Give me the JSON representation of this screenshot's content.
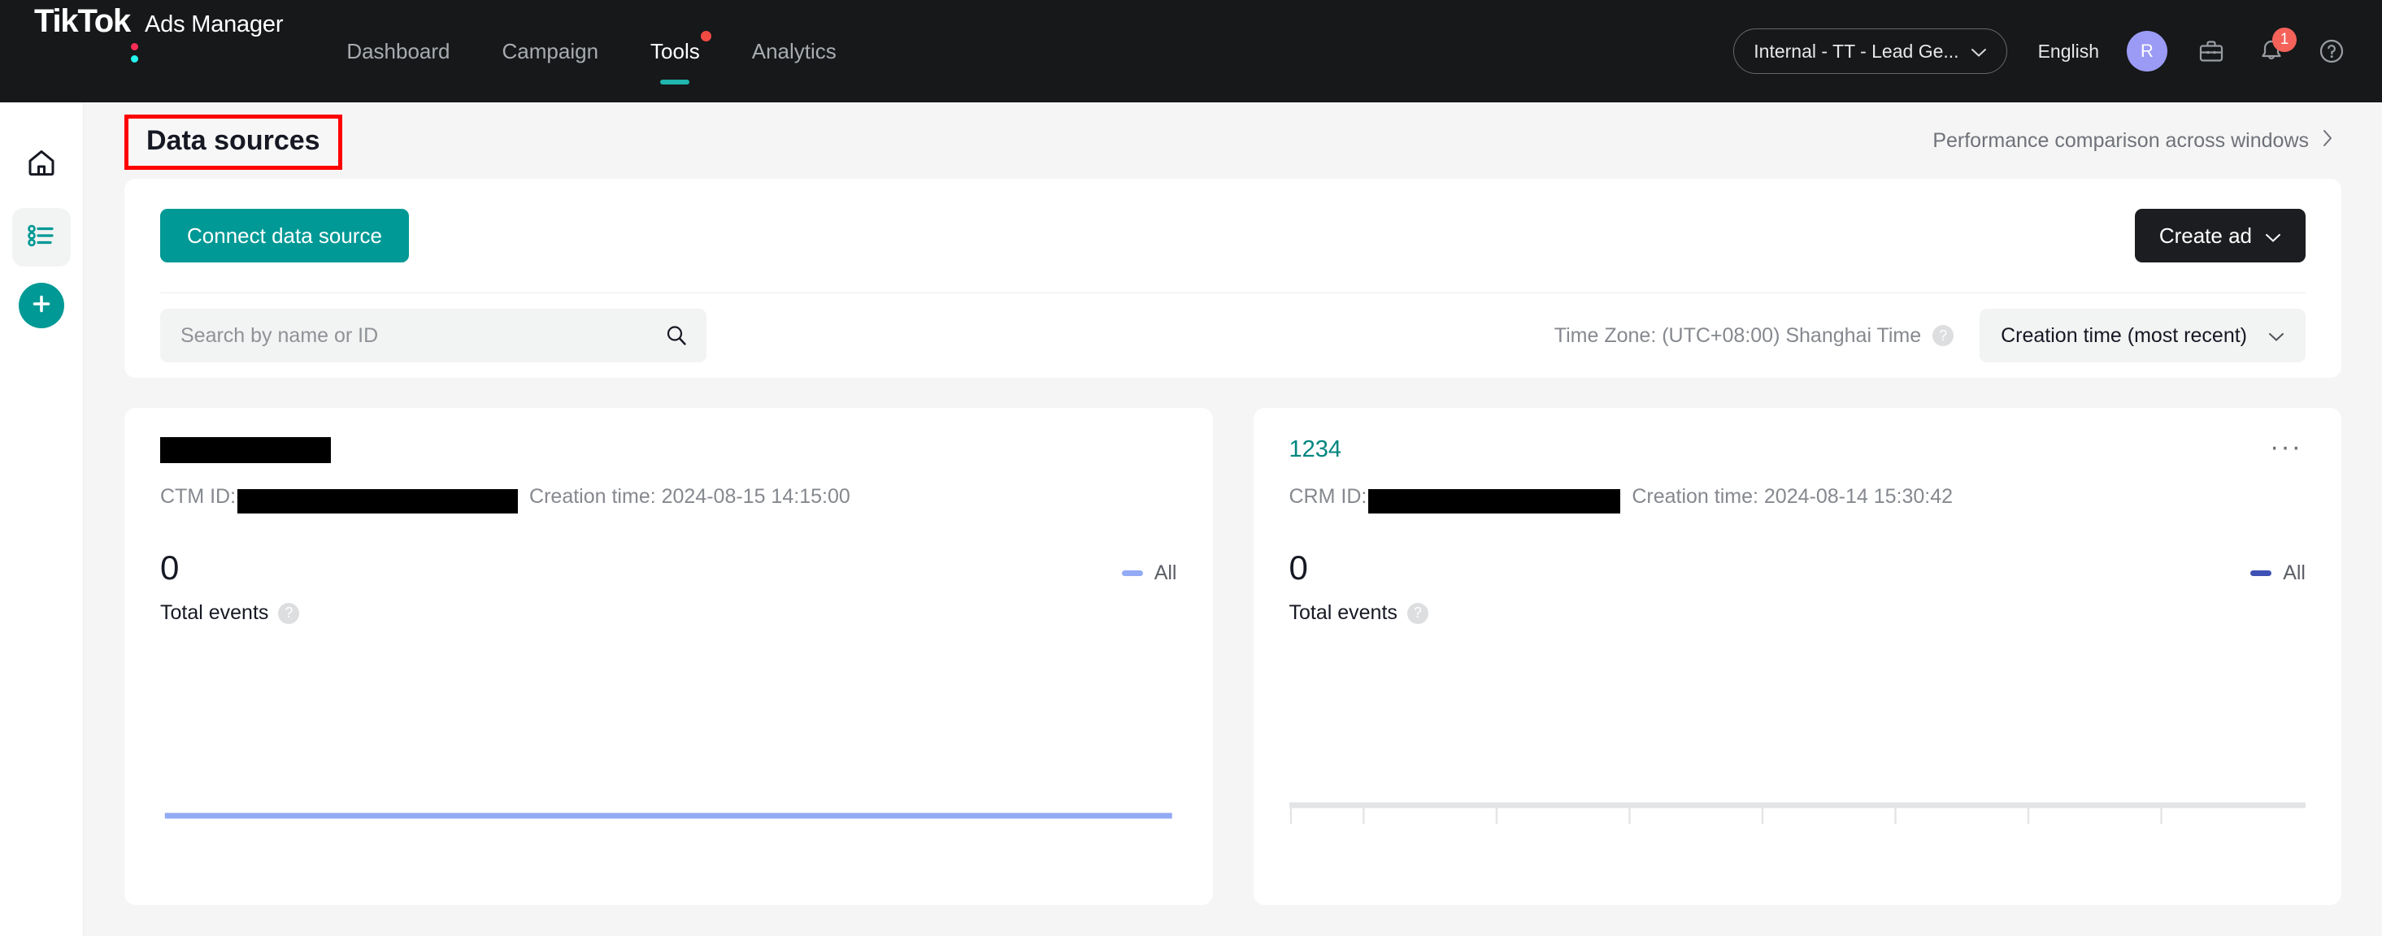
{
  "topnav": {
    "brand_name": "TikTok",
    "brand_sub": "Ads Manager",
    "tabs": [
      {
        "label": "Dashboard",
        "active": false,
        "dot": false
      },
      {
        "label": "Campaign",
        "active": false,
        "dot": false
      },
      {
        "label": "Tools",
        "active": true,
        "dot": true
      },
      {
        "label": "Analytics",
        "active": false,
        "dot": false
      }
    ],
    "account": "Internal - TT - Lead Ge...",
    "language": "English",
    "avatar_initial": "R",
    "notification_count": "1",
    "icons": {
      "briefcase": "briefcase-icon",
      "bell": "bell-icon",
      "help": "help-circle-icon",
      "chevron": "chevron-down-icon"
    }
  },
  "sidebar": {
    "items": [
      {
        "name": "home",
        "label": "Home",
        "active": false
      },
      {
        "name": "data-sources",
        "label": "Data sources",
        "active": true
      }
    ],
    "fab_label": "Create"
  },
  "page": {
    "title": "Data sources",
    "performance_link": "Performance comparison across windows",
    "performance_chevron": "›"
  },
  "toolbar": {
    "connect_label": "Connect data source",
    "create_ad_label": "Create ad",
    "search_placeholder": "Search by name or ID",
    "search_value": "",
    "timezone_label": "Time Zone: (UTC+08:00) Shanghai Time",
    "sort_value": "Creation time (most recent)",
    "help_glyph": "?"
  },
  "cards": [
    {
      "name_redacted": true,
      "name": "",
      "id_label": "CTM ID:",
      "id_redacted": true,
      "creation_label": "Creation time: 2024-08-15 14:15:00",
      "metric_value": "0",
      "metric_label": "Total events",
      "legend_label": "All",
      "legend_color": "#93aaf5",
      "has_menu": false,
      "chart": {
        "type": "line",
        "series_name": "All",
        "color": "#93aaf5",
        "values": [
          0,
          0,
          0,
          0,
          0,
          0,
          0,
          0
        ],
        "axis_visible": false,
        "ticks": 0
      }
    },
    {
      "name_redacted": false,
      "name": "1234",
      "id_label": "CRM ID:",
      "id_redacted": true,
      "creation_label": "Creation time: 2024-08-14 15:30:42",
      "metric_value": "0",
      "metric_label": "Total events",
      "legend_label": "All",
      "legend_color": "#3f51b5",
      "has_menu": true,
      "menu_glyph": "···",
      "chart": {
        "type": "line",
        "series_name": "All",
        "color": "#d8d9da",
        "values": [
          0,
          0,
          0,
          0,
          0,
          0,
          0,
          0
        ],
        "axis_visible": true,
        "ticks": 8
      }
    }
  ],
  "colors": {
    "brand_teal": "#009995",
    "nav_bg": "#16181a",
    "accent_red": "#ff0000",
    "badge_red": "#f4625a",
    "link_teal": "#00857f"
  }
}
